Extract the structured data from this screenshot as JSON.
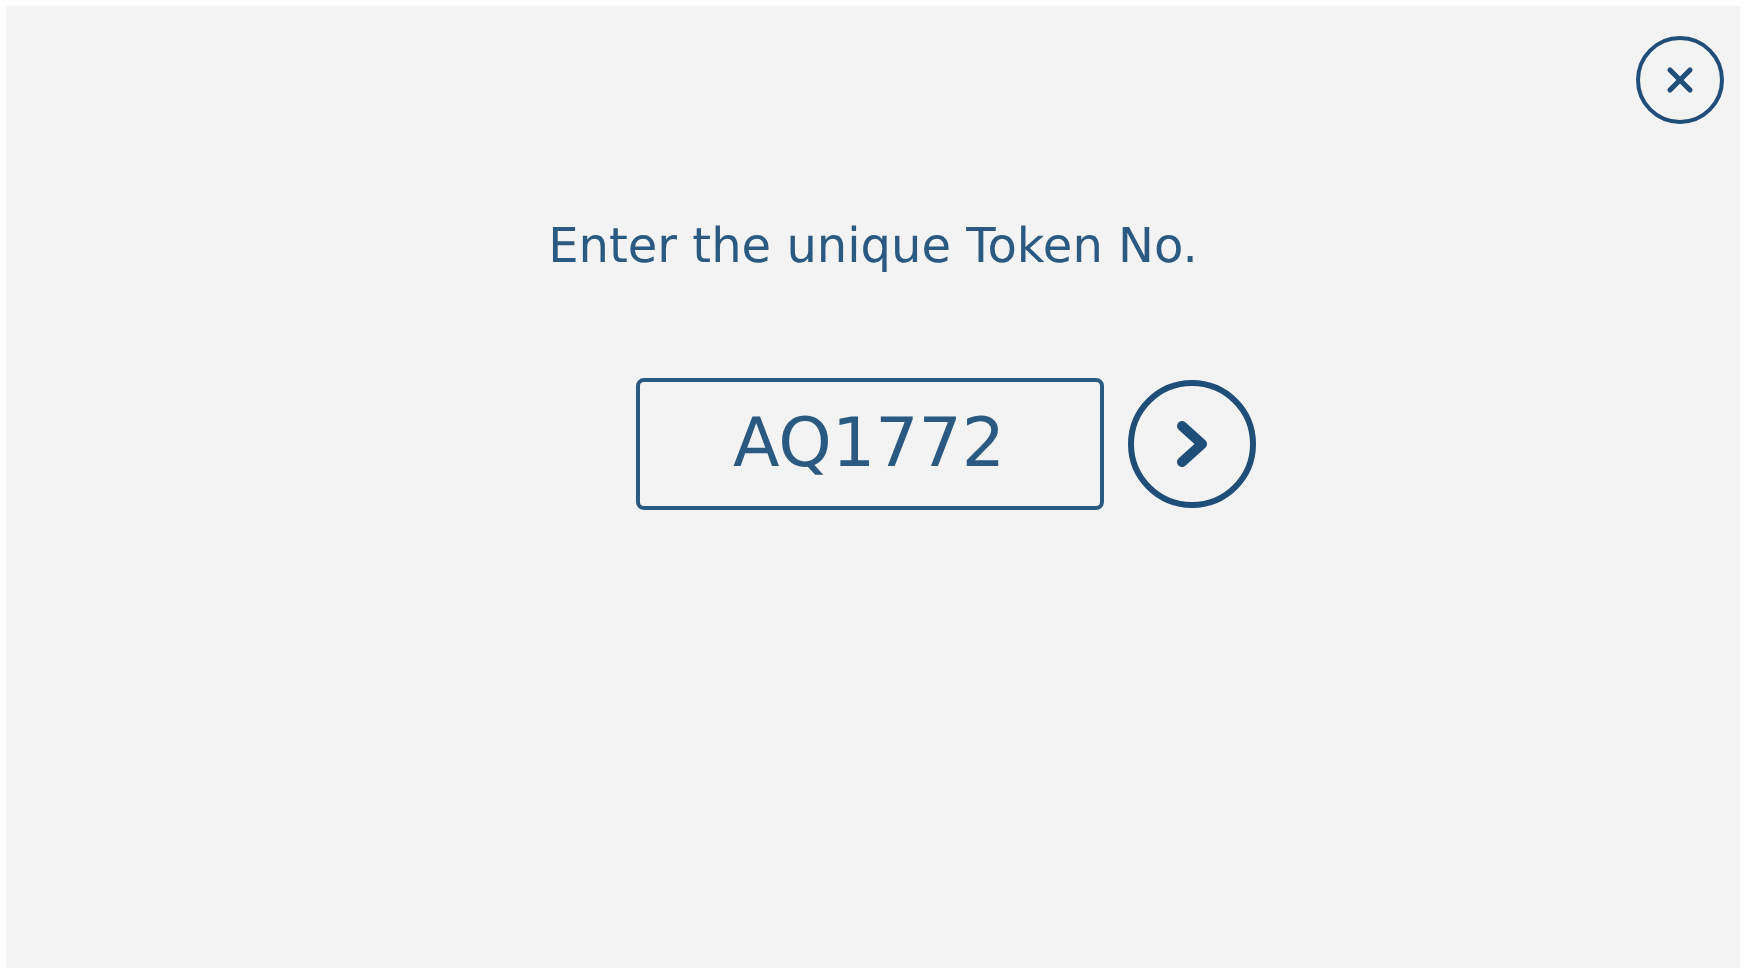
{
  "prompt": "Enter the unique Token No.",
  "token_field": {
    "value": "AQ1772"
  }
}
